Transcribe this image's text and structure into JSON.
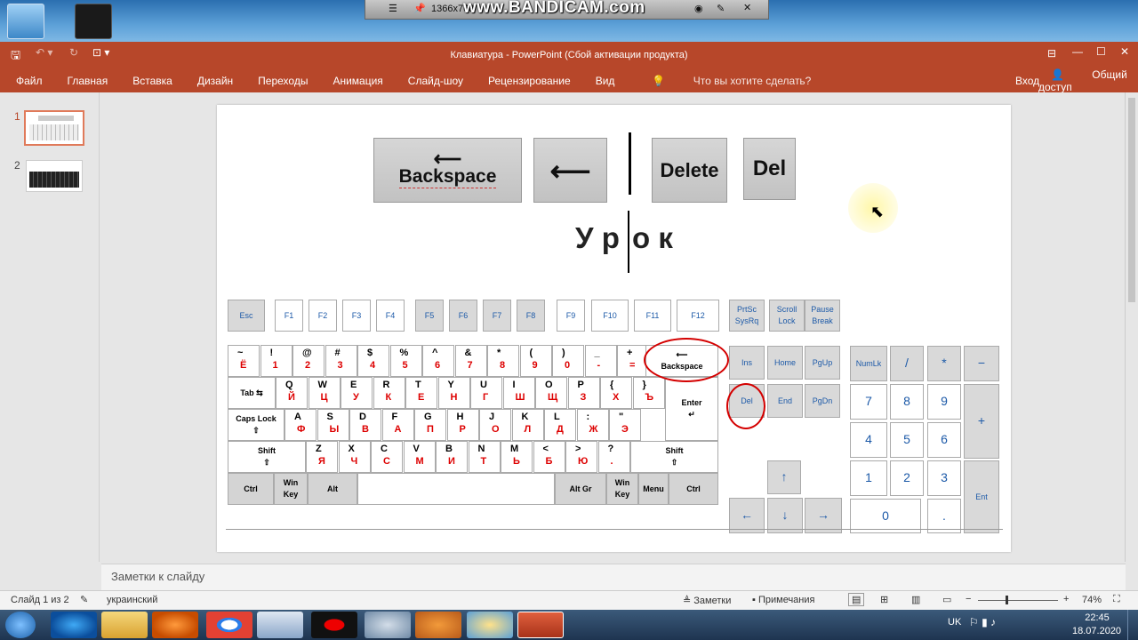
{
  "recording": {
    "resolution": "1366x768",
    "brand": "www.BANDICAM.com"
  },
  "window": {
    "title": "Клавиатура - PowerPoint (Сбой активации продукта)"
  },
  "ribbon": {
    "tabs": [
      "Файл",
      "Главная",
      "Вставка",
      "Дизайн",
      "Переходы",
      "Анимация",
      "Слайд-шоу",
      "Рецензирование",
      "Вид"
    ],
    "tell_me": "Что вы хотите сделать?",
    "signin": "Вход",
    "share": "Общий доступ"
  },
  "thumbnails": [
    {
      "num": "1"
    },
    {
      "num": "2"
    }
  ],
  "slide": {
    "key_backspace": "Backspace",
    "key_delete": "Delete",
    "key_del": "Del",
    "word_left": "У р",
    "word_right": "о к",
    "keyboard": {
      "fkeys": [
        "Esc",
        "F1",
        "F2",
        "F3",
        "F4",
        "F5",
        "F6",
        "F7",
        "F8",
        "F9",
        "F10",
        "F11",
        "F12"
      ],
      "sys": [
        "PrtSc\nSysRq",
        "Scroll\nLock",
        "Pause\nBreak"
      ],
      "row1_lat": [
        "~",
        "!",
        "@",
        "#",
        "$",
        "%",
        "^",
        "&",
        "*",
        "(",
        ")",
        "_",
        "+"
      ],
      "row1_cyr": [
        "Ё",
        "1",
        "2",
        "3",
        "4",
        "5",
        "6",
        "7",
        "8",
        "9",
        "0",
        "-",
        "="
      ],
      "row2_lat": [
        "Q",
        "W",
        "E",
        "R",
        "T",
        "Y",
        "U",
        "I",
        "O",
        "P",
        "{",
        "}"
      ],
      "row2_cyr": [
        "Й",
        "Ц",
        "У",
        "К",
        "Е",
        "Н",
        "Г",
        "Ш",
        "Щ",
        "З",
        "Х",
        "Ъ"
      ],
      "row3_lat": [
        "A",
        "S",
        "D",
        "F",
        "G",
        "H",
        "J",
        "K",
        "L",
        ":",
        "\""
      ],
      "row3_cyr": [
        "Ф",
        "Ы",
        "В",
        "А",
        "П",
        "Р",
        "О",
        "Л",
        "Д",
        "Ж",
        "Э"
      ],
      "row4_lat": [
        "Z",
        "X",
        "C",
        "V",
        "B",
        "N",
        "M",
        "<",
        ">",
        "?"
      ],
      "row4_cyr": [
        "Я",
        "Ч",
        "С",
        "М",
        "И",
        "Т",
        "Ь",
        "Б",
        "Ю",
        "."
      ],
      "tab": "Tab",
      "caps": "Caps Lock",
      "shift": "Shift",
      "enter": "Enter",
      "backspace": "Backspace",
      "ctrl": "Ctrl",
      "win": "Win\nKey",
      "alt": "Alt",
      "altgr": "Alt Gr",
      "menu": "Menu",
      "nav": [
        "Ins",
        "Home",
        "PgUp",
        "Del",
        "End",
        "PgDn"
      ],
      "numpad": [
        "NumLk",
        "/",
        "*",
        "−",
        "7",
        "8",
        "9",
        "+",
        "4",
        "5",
        "6",
        "1",
        "2",
        "3",
        "Ent",
        "0",
        "."
      ]
    }
  },
  "notes": {
    "placeholder": "Заметки к слайду"
  },
  "status": {
    "slide_info": "Слайд 1 из 2",
    "language": "украинский",
    "notes_btn": "Заметки",
    "comments_btn": "Примечания",
    "zoom": "74%"
  },
  "taskbar": {
    "lang": "UK",
    "time": "22:45",
    "date": "18.07.2020"
  }
}
